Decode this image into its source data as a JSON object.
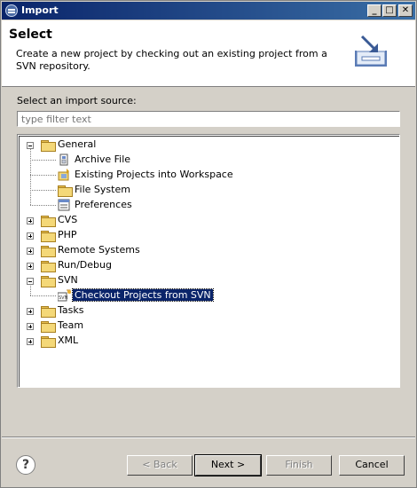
{
  "window": {
    "title": "Import"
  },
  "title_buttons": {
    "minimize": "_",
    "maximize": "□",
    "close": "✕"
  },
  "header": {
    "title": "Select",
    "description": "Create a new project by checking out an existing project from a SVN repository."
  },
  "source_label": "Select an import source:",
  "filter": {
    "placeholder": "type filter text",
    "value": ""
  },
  "tree": {
    "items": [
      {
        "label": "General",
        "icon": "folder-icon",
        "expanded": true,
        "level": 0
      },
      {
        "label": "Archive File",
        "icon": "archive-file-icon",
        "level": 1
      },
      {
        "label": "Existing Projects into Workspace",
        "icon": "existing-projects-icon",
        "level": 1
      },
      {
        "label": "File System",
        "icon": "folder-icon",
        "level": 1
      },
      {
        "label": "Preferences",
        "icon": "preferences-icon",
        "level": 1
      },
      {
        "label": "CVS",
        "icon": "folder-icon",
        "expanded": false,
        "level": 0
      },
      {
        "label": "PHP",
        "icon": "folder-icon",
        "expanded": false,
        "level": 0
      },
      {
        "label": "Remote Systems",
        "icon": "folder-icon",
        "expanded": false,
        "level": 0
      },
      {
        "label": "Run/Debug",
        "icon": "folder-icon",
        "expanded": false,
        "level": 0
      },
      {
        "label": "SVN",
        "icon": "folder-icon",
        "expanded": true,
        "level": 0
      },
      {
        "label": "Checkout Projects from SVN",
        "icon": "svn-checkout-icon",
        "level": 1,
        "selected": true
      },
      {
        "label": "Tasks",
        "icon": "folder-icon",
        "expanded": false,
        "level": 0
      },
      {
        "label": "Team",
        "icon": "folder-icon",
        "expanded": false,
        "level": 0
      },
      {
        "label": "XML",
        "icon": "folder-icon",
        "expanded": false,
        "level": 0
      }
    ]
  },
  "buttons": {
    "help": "?",
    "back": "< Back",
    "next": "Next >",
    "finish": "Finish",
    "cancel": "Cancel"
  }
}
